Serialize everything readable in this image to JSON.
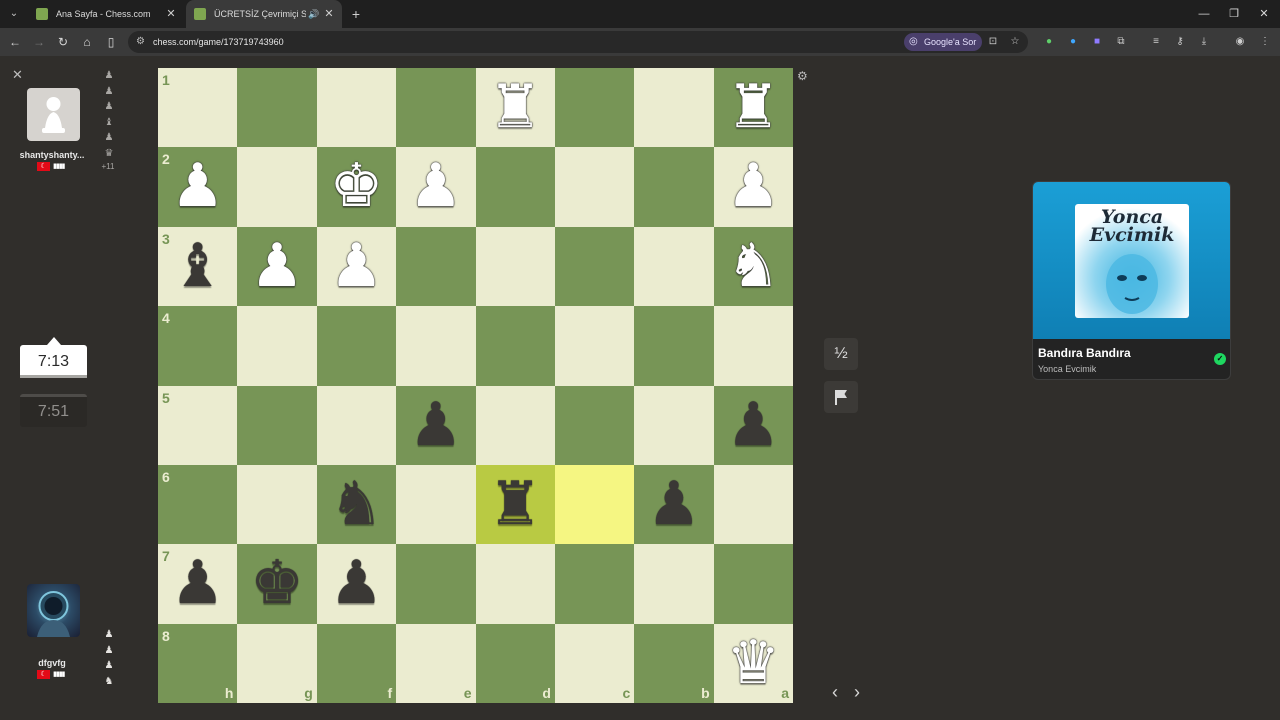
{
  "browser": {
    "tabs": [
      {
        "title": "Ana Sayfa - Chess.com",
        "active": false
      },
      {
        "title": "ÜCRETSİZ Çevrimiçi Satranç",
        "active": true
      }
    ],
    "url": "chess.com/game/173719743960",
    "google_sor_label": "Google'a Sor"
  },
  "players": {
    "top": {
      "name": "shantyshanty...",
      "flag": "TR",
      "clock": "7:51",
      "captured_icons": [
        "♟",
        "♟",
        "♟",
        "♝",
        "♟",
        "♛"
      ],
      "material_diff": "+11"
    },
    "bottom": {
      "name": "dfgvfg",
      "flag": "TR",
      "clock": "7:13",
      "captured_icons": [
        "♟",
        "♟",
        "♟",
        "♞"
      ]
    }
  },
  "board": {
    "files": [
      "h",
      "g",
      "f",
      "e",
      "d",
      "c",
      "b",
      "a"
    ],
    "ranks": [
      "1",
      "2",
      "3",
      "4",
      "5",
      "6",
      "7",
      "8"
    ],
    "pieces": [
      {
        "square": "d1",
        "piece": "rook",
        "color": "white"
      },
      {
        "square": "a1",
        "piece": "rook",
        "color": "white"
      },
      {
        "square": "h2",
        "piece": "pawn",
        "color": "white"
      },
      {
        "square": "f2",
        "piece": "king",
        "color": "white"
      },
      {
        "square": "e2",
        "piece": "pawn",
        "color": "white"
      },
      {
        "square": "a2",
        "piece": "pawn",
        "color": "white"
      },
      {
        "square": "h3",
        "piece": "bishop",
        "color": "black"
      },
      {
        "square": "g3",
        "piece": "pawn",
        "color": "white"
      },
      {
        "square": "f3",
        "piece": "pawn",
        "color": "white"
      },
      {
        "square": "a3",
        "piece": "knight",
        "color": "white"
      },
      {
        "square": "e5",
        "piece": "pawn",
        "color": "black"
      },
      {
        "square": "a5",
        "piece": "pawn",
        "color": "black"
      },
      {
        "square": "f6",
        "piece": "knight",
        "color": "black"
      },
      {
        "square": "d6",
        "piece": "rook",
        "color": "black"
      },
      {
        "square": "b6",
        "piece": "pawn",
        "color": "black"
      },
      {
        "square": "h7",
        "piece": "pawn",
        "color": "black"
      },
      {
        "square": "g7",
        "piece": "king",
        "color": "black"
      },
      {
        "square": "f7",
        "piece": "pawn",
        "color": "black"
      },
      {
        "square": "a8",
        "piece": "queen",
        "color": "white"
      }
    ],
    "highlighted_squares": [
      "d6",
      "c6"
    ],
    "colors": {
      "light": "#ebecd0",
      "dark": "#779556",
      "highlight": "#f5f682"
    }
  },
  "controls": {
    "draw_label": "½",
    "resign_icon": "flag-icon"
  },
  "media": {
    "title": "Bandıra Bandıra",
    "artist": "Yonca Evcimik",
    "art_text": "Yonca Evcimik"
  }
}
